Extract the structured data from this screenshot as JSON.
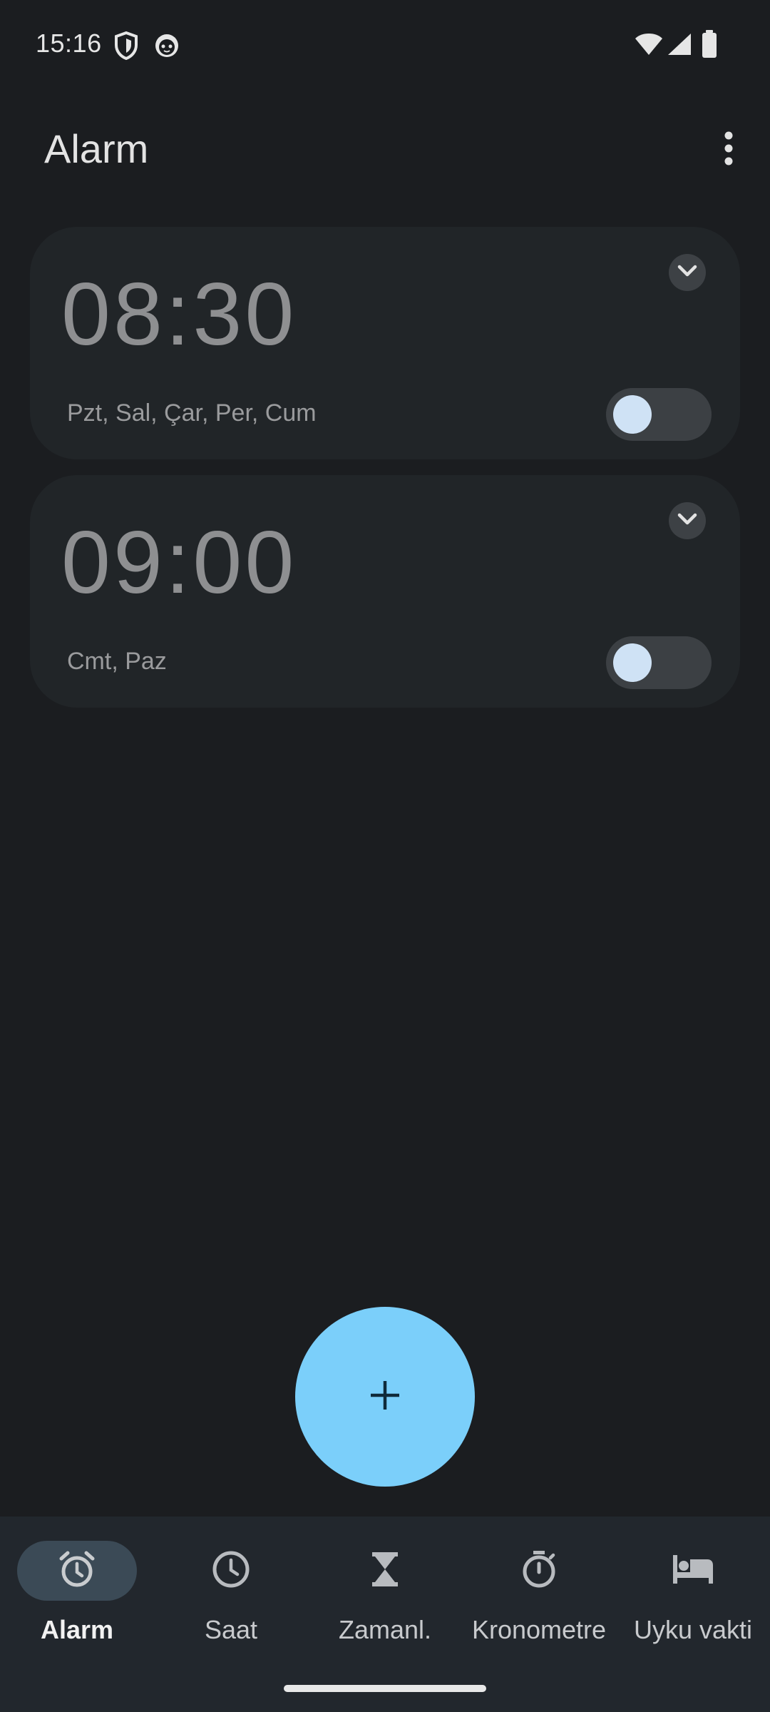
{
  "status_bar": {
    "time": "15:16",
    "left_icons": [
      "shield-icon",
      "cat-face-icon"
    ],
    "right_icons": [
      "wifi-icon",
      "signal-icon",
      "battery-icon"
    ]
  },
  "app_bar": {
    "title": "Alarm",
    "overflow_icon": "more-vert-icon"
  },
  "alarms": [
    {
      "time": "08:30",
      "days": "Pzt, Sal, Çar, Per, Cum",
      "enabled": false
    },
    {
      "time": "09:00",
      "days": "Cmt, Paz",
      "enabled": false
    }
  ],
  "fab": {
    "icon": "plus-icon"
  },
  "bottom_nav": {
    "items": [
      {
        "label": "Alarm",
        "icon": "alarm-clock-icon",
        "active": true
      },
      {
        "label": "Saat",
        "icon": "clock-icon",
        "active": false
      },
      {
        "label": "Zamanl.",
        "icon": "hourglass-icon",
        "active": false
      },
      {
        "label": "Kronometre",
        "icon": "stopwatch-icon",
        "active": false
      },
      {
        "label": "Uyku vakti",
        "icon": "bed-icon",
        "active": false
      }
    ]
  },
  "colors": {
    "background": "#1b1d20",
    "card": "#212528",
    "fab": "#7bcffa",
    "nav_background": "#22272d",
    "nav_active_pill": "#3b4a56",
    "toggle_knob": "#cfe2f5"
  }
}
